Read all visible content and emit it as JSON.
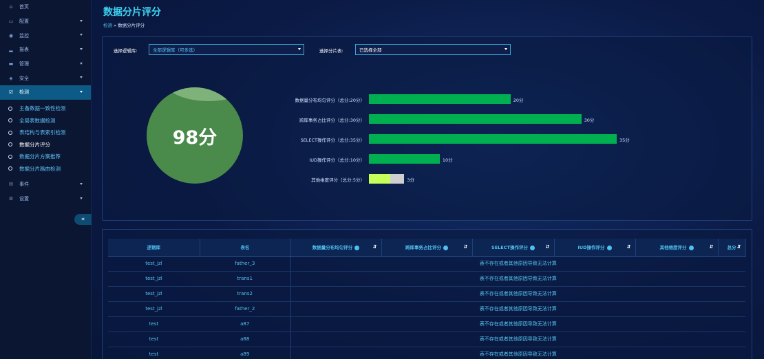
{
  "sidebar": {
    "items": [
      {
        "label": "首页",
        "icon": "home-icon"
      },
      {
        "label": "配置",
        "icon": "monitor-icon"
      },
      {
        "label": "监控",
        "icon": "eye-icon"
      },
      {
        "label": "报表",
        "icon": "chart-icon"
      },
      {
        "label": "管理",
        "icon": "folder-icon"
      },
      {
        "label": "安全",
        "icon": "shield-icon"
      },
      {
        "label": "检测",
        "icon": "check-icon"
      }
    ],
    "sub_items": [
      "主备数据一致性检测",
      "全局表数据检测",
      "表结构与表索引检测",
      "数据分片评分",
      "数据分片方案推荐",
      "数据分片路由检测"
    ],
    "bottom_items": [
      {
        "label": "事件",
        "icon": "mail-icon"
      },
      {
        "label": "设置",
        "icon": "gear-icon"
      }
    ],
    "collapse_label": "«"
  },
  "header": {
    "title": "数据分片评分",
    "breadcrumb_parent": "检测",
    "breadcrumb_sep": "»",
    "breadcrumb_current": "数据分片评分"
  },
  "filters": {
    "db_label": "选择逻辑库:",
    "db_value": "全部逻辑库（可多选）",
    "table_label": "选择分片表:",
    "table_value": "已选择全部"
  },
  "score": {
    "value": "98分"
  },
  "chart_data": {
    "type": "bar",
    "orientation": "horizontal",
    "categories": [
      "数据量分布均匀评分（总分:20分）",
      "跨库事务占比评分（总分:30分）",
      "SELECT操作评分（总分:35分）",
      "IUD操作评分（总分:10分）",
      "其他维度评分（总分:5分）"
    ],
    "values": [
      20,
      30,
      35,
      10,
      3
    ],
    "max_values": [
      20,
      30,
      35,
      10,
      5
    ],
    "value_labels": [
      "20分",
      "30分",
      "35分",
      "10分",
      "3分"
    ],
    "colors": [
      "#00b050",
      "#00b050",
      "#00b050",
      "#00b050",
      "#c6ff5a"
    ],
    "remainder_color": "#cfcfcf"
  },
  "table": {
    "headers": [
      "逻辑库",
      "表名",
      "数据量分布均匀评分",
      "跨库事务占比评分",
      "SELECT操作评分",
      "IUD操作评分",
      "其他维度评分",
      "总分"
    ],
    "message": "表不存在或者其他原因导致无法计算",
    "rows": [
      [
        "test_jzl",
        "father_3"
      ],
      [
        "test_jzl",
        "trans1"
      ],
      [
        "test_jzl",
        "trans2"
      ],
      [
        "test_jzl",
        "father_2"
      ],
      [
        "test",
        "a87"
      ],
      [
        "test",
        "a88"
      ],
      [
        "test",
        "a89"
      ]
    ]
  }
}
